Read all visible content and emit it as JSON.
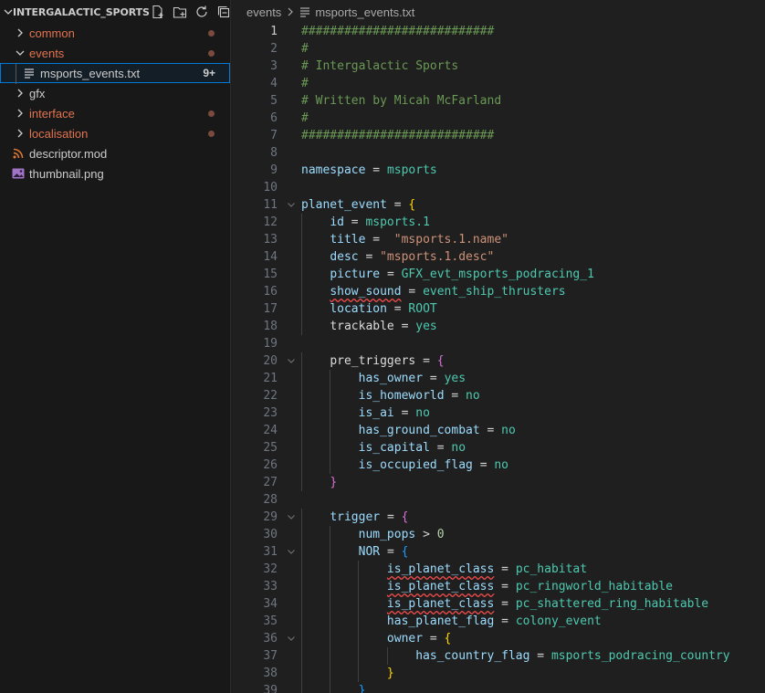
{
  "explorer": {
    "project_title": "INTERGALACTIC_SPORTS",
    "items": [
      {
        "label": "common",
        "kind": "folder",
        "expanded": false,
        "modified": true
      },
      {
        "label": "events",
        "kind": "folder",
        "expanded": true,
        "modified": true
      },
      {
        "label": "msports_events.txt",
        "kind": "file",
        "badge": "9+",
        "selected": true
      },
      {
        "label": "gfx",
        "kind": "folder",
        "expanded": false,
        "modified": false
      },
      {
        "label": "interface",
        "kind": "folder",
        "expanded": false,
        "modified": true
      },
      {
        "label": "localisation",
        "kind": "folder",
        "expanded": false,
        "modified": true
      },
      {
        "label": "descriptor.mod",
        "kind": "file",
        "icon": "rss-icon"
      },
      {
        "label": "thumbnail.png",
        "kind": "file",
        "icon": "image-icon"
      }
    ]
  },
  "breadcrumb": {
    "folder": "events",
    "file": "msports_events.txt"
  },
  "editor": {
    "current_line": 1,
    "lines": [
      {
        "n": "1",
        "text": "###########################"
      },
      {
        "n": "2",
        "text": "#"
      },
      {
        "n": "3",
        "text": "# Intergalactic Sports"
      },
      {
        "n": "4",
        "text": "#"
      },
      {
        "n": "5",
        "text": "# Written by Micah McFarland"
      },
      {
        "n": "6",
        "text": "#"
      },
      {
        "n": "7",
        "text": "###########################"
      },
      {
        "n": "8",
        "text": ""
      },
      {
        "n": "9",
        "text": "namespace = msports"
      },
      {
        "n": "10",
        "text": ""
      },
      {
        "n": "11",
        "text": "planet_event = {"
      },
      {
        "n": "12",
        "text": "    id = msports.1"
      },
      {
        "n": "13",
        "text": "    title =  \"msports.1.name\""
      },
      {
        "n": "14",
        "text": "    desc = \"msports.1.desc\""
      },
      {
        "n": "15",
        "text": "    picture = GFX_evt_msports_podracing_1"
      },
      {
        "n": "16",
        "text": "    show_sound = event_ship_thrusters"
      },
      {
        "n": "17",
        "text": "    location = ROOT"
      },
      {
        "n": "18",
        "text": "    trackable = yes"
      },
      {
        "n": "19",
        "text": ""
      },
      {
        "n": "20",
        "text": "    pre_triggers = {"
      },
      {
        "n": "21",
        "text": "        has_owner = yes"
      },
      {
        "n": "22",
        "text": "        is_homeworld = no"
      },
      {
        "n": "23",
        "text": "        is_ai = no"
      },
      {
        "n": "24",
        "text": "        has_ground_combat = no"
      },
      {
        "n": "25",
        "text": "        is_capital = no"
      },
      {
        "n": "26",
        "text": "        is_occupied_flag = no"
      },
      {
        "n": "27",
        "text": "    }"
      },
      {
        "n": "28",
        "text": ""
      },
      {
        "n": "29",
        "text": "    trigger = {"
      },
      {
        "n": "30",
        "text": "        num_pops > 0"
      },
      {
        "n": "31",
        "text": "        NOR = {"
      },
      {
        "n": "32",
        "text": "            is_planet_class = pc_habitat"
      },
      {
        "n": "33",
        "text": "            is_planet_class = pc_ringworld_habitable"
      },
      {
        "n": "34",
        "text": "            is_planet_class = pc_shattered_ring_habitable"
      },
      {
        "n": "35",
        "text": "            has_planet_flag = colony_event"
      },
      {
        "n": "36",
        "text": "            owner = {"
      },
      {
        "n": "37",
        "text": "                has_country_flag = msports_podracing_country"
      },
      {
        "n": "38",
        "text": "            }"
      },
      {
        "n": "39",
        "text": "        }"
      }
    ]
  },
  "colors": {
    "accent": "#0078d4",
    "modified": "#e2734f",
    "comment": "#6a9955",
    "key": "#9cdcfe",
    "value": "#4ec9b0",
    "string": "#ce9178"
  }
}
